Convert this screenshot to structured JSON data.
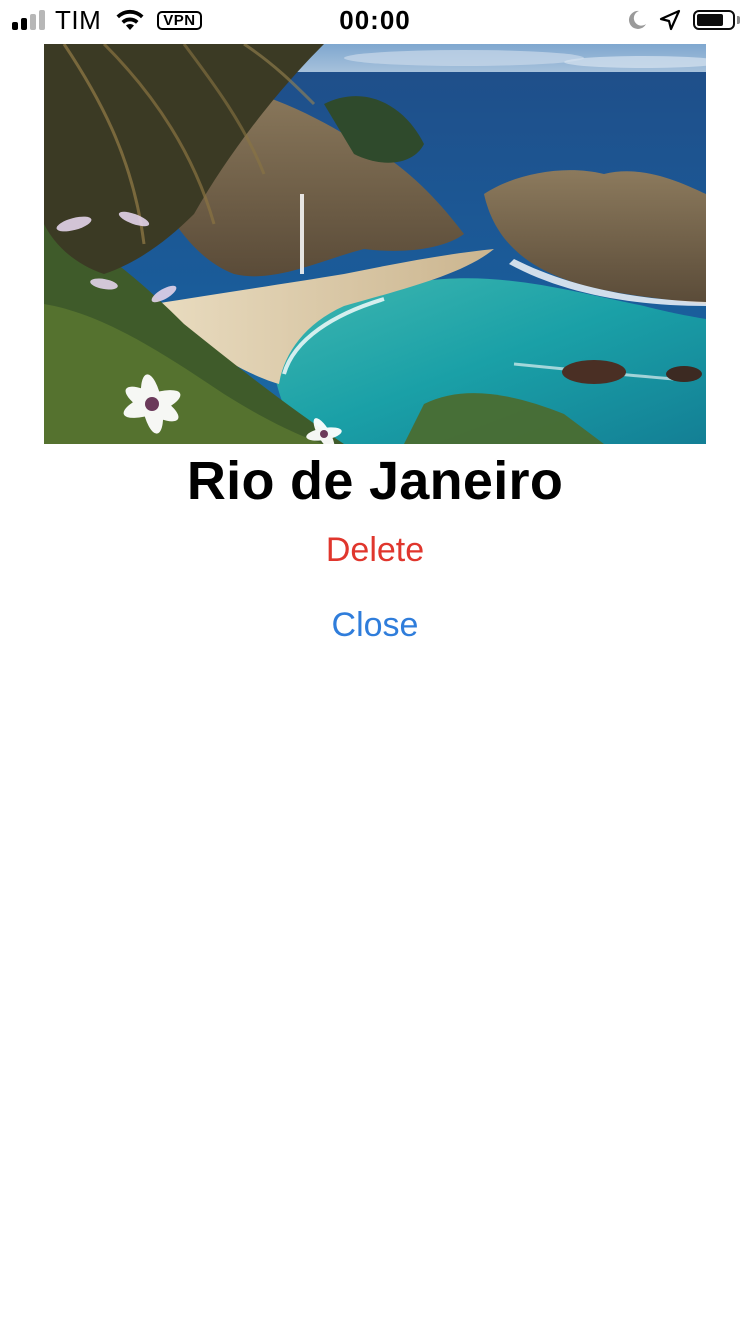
{
  "status_bar": {
    "carrier": "TIM",
    "vpn_label": "VPN",
    "time": "00:00",
    "signal_bars_active": 2,
    "signal_bars_total": 4,
    "battery_level": 0.75,
    "icons": [
      "signal-icon",
      "wifi-icon",
      "vpn-badge",
      "moon-icon",
      "location-arrow-icon",
      "battery-icon"
    ]
  },
  "photo": {
    "subject": "coastal cove with waterfall, beach, turquoise sea and palm fronds",
    "name": "city-photo"
  },
  "detail": {
    "title": "Rio de Janeiro",
    "delete_label": "Delete",
    "close_label": "Close"
  },
  "colors": {
    "delete": "#e0362d",
    "close": "#2f7ddb",
    "background": "#ffffff",
    "text": "#000000"
  }
}
